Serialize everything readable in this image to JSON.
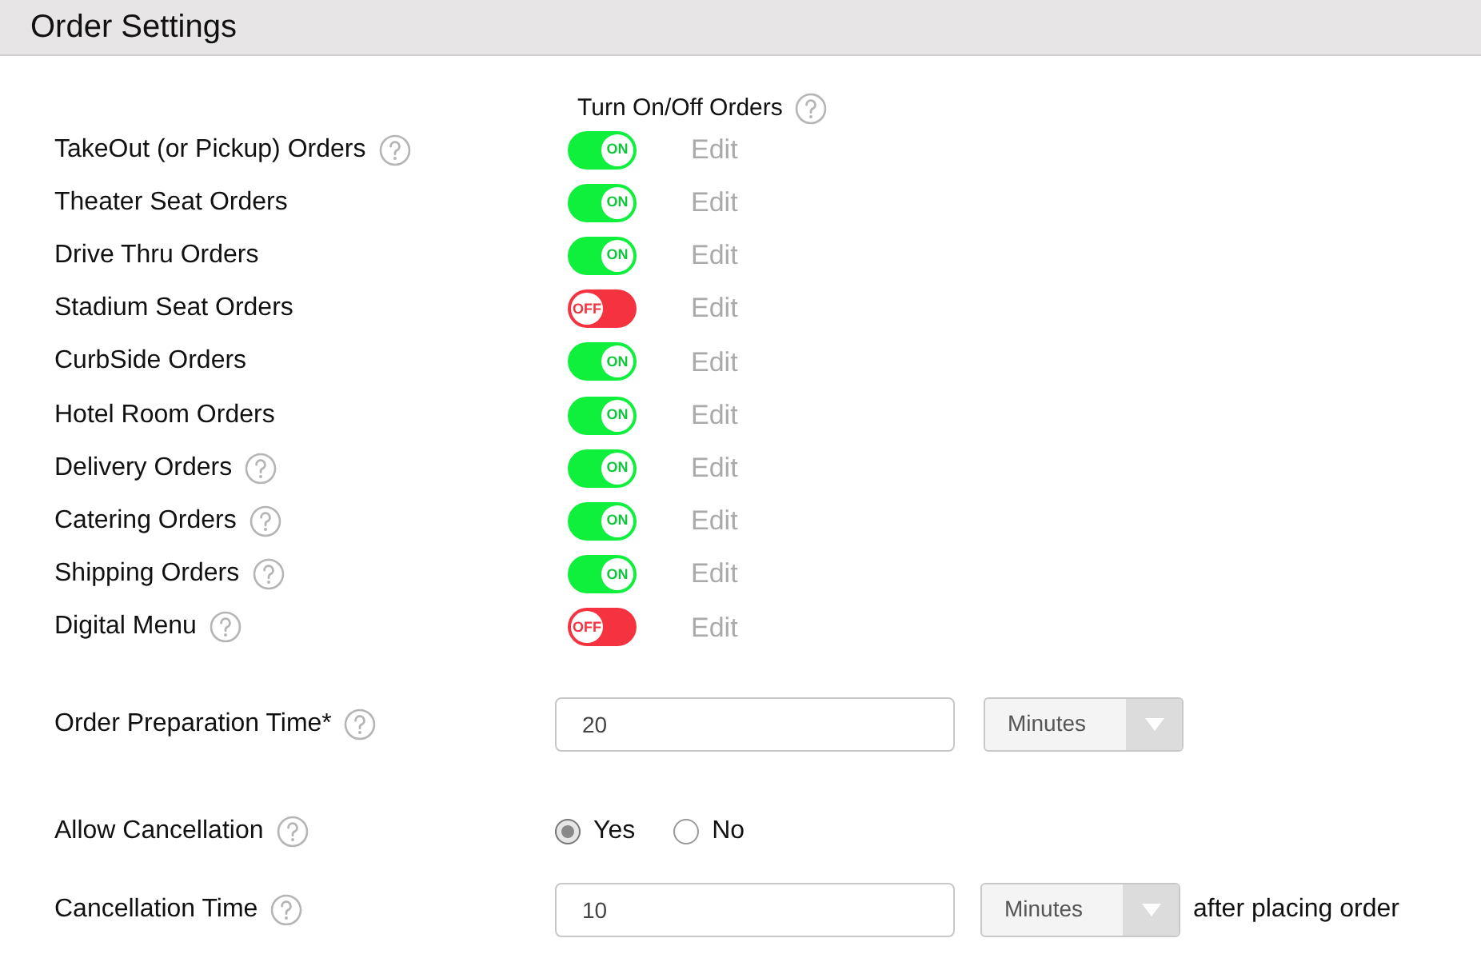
{
  "header": {
    "title": "Order Settings"
  },
  "toggle_column": {
    "title": "Turn On/Off Orders",
    "help": true
  },
  "order_types": [
    {
      "label": "TakeOut (or Pickup) Orders",
      "help": true,
      "on": true,
      "switch_text": "ON",
      "action": "Edit"
    },
    {
      "label": "Theater Seat Orders",
      "help": false,
      "on": true,
      "switch_text": "ON",
      "action": "Edit"
    },
    {
      "label": "Drive Thru Orders",
      "help": false,
      "on": true,
      "switch_text": "ON",
      "action": "Edit"
    },
    {
      "label": "Stadium Seat Orders",
      "help": false,
      "on": false,
      "switch_text": "OFF",
      "action": "Edit"
    },
    {
      "label": "CurbSide Orders",
      "help": false,
      "on": true,
      "switch_text": "ON",
      "action": "Edit"
    },
    {
      "label": "Hotel Room Orders",
      "help": false,
      "on": true,
      "switch_text": "ON",
      "action": "Edit"
    },
    {
      "label": "Delivery Orders",
      "help": true,
      "on": true,
      "switch_text": "ON",
      "action": "Edit"
    },
    {
      "label": "Catering Orders",
      "help": true,
      "on": true,
      "switch_text": "ON",
      "action": "Edit"
    },
    {
      "label": "Shipping Orders",
      "help": true,
      "on": true,
      "switch_text": "ON",
      "action": "Edit"
    },
    {
      "label": "Digital Menu",
      "help": true,
      "on": false,
      "switch_text": "OFF",
      "action": "Edit"
    }
  ],
  "preparation_time": {
    "label": "Order Preparation Time*",
    "help": true,
    "value": "20",
    "unit": "Minutes"
  },
  "allow_cancellation": {
    "label": "Allow Cancellation",
    "help": true,
    "options": [
      {
        "label": "Yes",
        "selected": true
      },
      {
        "label": "No",
        "selected": false
      }
    ]
  },
  "cancellation_time": {
    "label": "Cancellation Time",
    "help": true,
    "value": "10",
    "unit": "Minutes",
    "suffix": "after placing order"
  }
}
